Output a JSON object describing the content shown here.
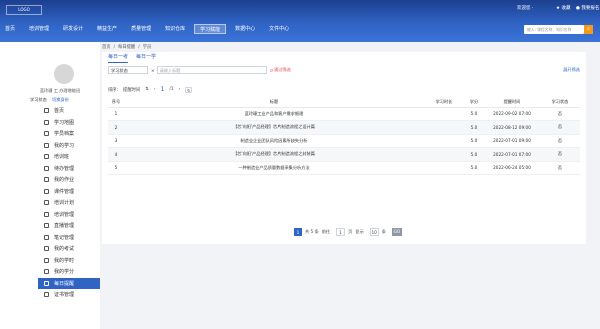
{
  "header": {
    "logo": "LOGO",
    "welcome": "欢迎您 ·",
    "favorites": "收藏",
    "home_label": "我要报名",
    "nav": [
      "首页",
      "培训管理",
      "研发设计",
      "精益生产",
      "质量管理",
      "知识仓库",
      "学习赋能",
      "数据中心",
      "文件中心"
    ],
    "active_nav_index": 6,
    "search_placeholder": "输入: 课程名称、知识名称",
    "search_icon": "search-icon",
    "accent": "#2f63c4"
  },
  "sidebar": {
    "user_line": "蓝玲珊 工   办理增能班",
    "links": [
      "学习状态",
      "切换身份"
    ],
    "menu": [
      "首页",
      "学习地图",
      "学员档案",
      "我的学习",
      "培训班",
      "待办管理",
      "我的作业",
      "课件管理",
      "培训计划",
      "培训管理",
      "直播管理",
      "笔记管理",
      "我的考试",
      "我的学时",
      "我的学分",
      "每日提醒",
      "证书管理"
    ],
    "active_index": 15
  },
  "breadcrumb": [
    "首页",
    "每日提醒",
    "学员"
  ],
  "tabs": [
    "每日一考",
    "每日一学"
  ],
  "active_tab": 0,
  "filter": {
    "status_value": "学习状态",
    "input_placeholder": "请输入标题",
    "reset": "通过筛选",
    "export": "展开筛选"
  },
  "sort": {
    "label": "排序:",
    "option": "提醒时间",
    "page": "1",
    "total_pages": "/1"
  },
  "table": {
    "columns": [
      "序号",
      "标题",
      "学习时长",
      "学分",
      "提醒时间",
      "学习状态"
    ],
    "rows": [
      [
        "1",
        "蓝玲珊工业产品和客户需求细理",
        "",
        "5.0",
        "2022-09-02 07:00",
        "否"
      ],
      [
        "2",
        "【芯'向阳'产品经理】芯片制造流程之设计篇",
        "",
        "5.0",
        "2022-08-12 09:00",
        "否"
      ],
      [
        "3",
        "制造业企业团队风险因素所缺失分析",
        "",
        "5.0",
        "2022-07-01 09:00",
        "否"
      ],
      [
        "4",
        "【芯'向阳'产品经理】芯片制造流程之封装篇",
        "",
        "5.0",
        "2022-07-01 07:00",
        "否"
      ],
      [
        "5",
        "一种制造业产品质量数据采集分析方法",
        "",
        "5.0",
        "2022-06-24 05:00",
        "否"
      ]
    ]
  },
  "pagination": {
    "current": "1",
    "total": "共 5 条",
    "goto": "前往",
    "page_label": "页",
    "size_label": "显示",
    "size": "10",
    "size_unit": "条",
    "go": "GO"
  }
}
